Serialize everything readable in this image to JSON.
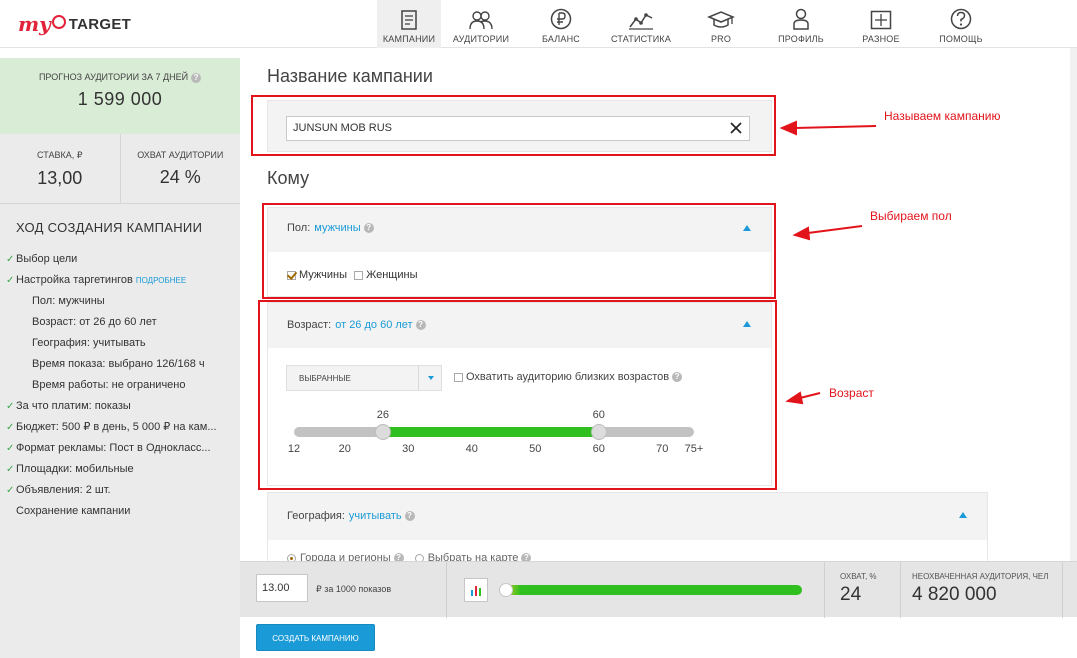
{
  "logo": {
    "my": "my",
    "target": "TARGET"
  },
  "nav": [
    {
      "label": "КАМПАНИИ",
      "icon": "document-icon",
      "active": true
    },
    {
      "label": "АУДИТОРИИ",
      "icon": "users-icon"
    },
    {
      "label": "БАЛАНС",
      "icon": "ruble-icon"
    },
    {
      "label": "СТАТИСТИКА",
      "icon": "line-chart-icon"
    },
    {
      "label": "PRO",
      "icon": "graduation-cap-icon"
    },
    {
      "label": "ПРОФИЛЬ",
      "icon": "person-icon"
    },
    {
      "label": "РАЗНОЕ",
      "icon": "grid-box-icon"
    },
    {
      "label": "ПОМОЩЬ",
      "icon": "help-circle-icon"
    }
  ],
  "sidebar": {
    "forecast_label": "ПРОГНОЗ АУДИТОРИИ ЗА 7 ДНЕЙ",
    "forecast_value": "1 599 000",
    "rate_label": "СТАВКА, ₽",
    "rate_value": "13,00",
    "reach_label": "ОХВАТ АУДИТОРИИ",
    "reach_value": "24 %",
    "steps_title": "ХОД СОЗДАНИЯ КАМПАНИИ",
    "steps": [
      {
        "text": "Выбор цели",
        "checked": true,
        "level": 0
      },
      {
        "text": "Настройка таргетингов",
        "checked": true,
        "level": 0,
        "more": "ПОДРОБНЕЕ"
      },
      {
        "text": "Пол: мужчины",
        "level": 1
      },
      {
        "text": "Возраст: от 26 до 60 лет",
        "level": 1
      },
      {
        "text": "География: учитывать",
        "level": 1
      },
      {
        "text": "Время показа: выбрано 126/168 ч",
        "level": 1
      },
      {
        "text": "Время работы: не ограничено",
        "level": 1
      },
      {
        "text": "За что платим: показы",
        "checked": true,
        "level": 0
      },
      {
        "text": "Бюджет: 500 ₽ в день, 5 000 ₽ на кам...",
        "checked": true,
        "level": 0
      },
      {
        "text": "Формат рекламы: Пост в Однокласс...",
        "checked": true,
        "level": 0
      },
      {
        "text": "Площадки: мобильные",
        "checked": true,
        "level": 0
      },
      {
        "text": "Объявления: 2 шт.",
        "checked": true,
        "level": 0
      },
      {
        "text": "Сохранение кампании",
        "level": 0
      }
    ]
  },
  "campaign": {
    "title": "Название кампании",
    "name_value": "JUNSUN MOB RUS"
  },
  "audience": {
    "title": "Кому",
    "gender": {
      "label": "Пол:",
      "value": "мужчины",
      "male": "Мужчины",
      "female": "Женщины",
      "male_checked": true,
      "female_checked": false
    },
    "age": {
      "label": "Возраст:",
      "value": "от 26 до 60 лет",
      "select_value": "ВЫБРАННЫЕ",
      "close_ages_label": "Охватить аудиторию близких возрастов",
      "min_value": "26",
      "max_value": "60",
      "range_min": 12,
      "range_max": 75,
      "selected_min": 26,
      "selected_max": 60,
      "ticks": [
        "12",
        "20",
        "30",
        "40",
        "50",
        "60",
        "70",
        "75+"
      ]
    },
    "geo": {
      "label": "География:",
      "value": "учитывать",
      "option1": "Города и регионы",
      "option2": "Выбрать на карте"
    }
  },
  "annotations": {
    "name": "Называем кампанию",
    "gender": "Выбираем пол",
    "age": "Возраст"
  },
  "bottom": {
    "rate_input": "13.00",
    "rate_label": "₽ за 1000 показов",
    "reach_label": "ОХВАТ, %",
    "reach_value": "24",
    "uncovered_label": "НЕОХВАЧЕННАЯ АУДИТОРИЯ, ЧЕЛ",
    "uncovered_value": "4 820 000",
    "create_button": "СОЗДАТЬ КАМПАНИЮ"
  },
  "colors": {
    "accent": "#1a9bd7",
    "highlight": "#e2141b",
    "success": "#2fbf1e",
    "logo": "#e2233a"
  }
}
